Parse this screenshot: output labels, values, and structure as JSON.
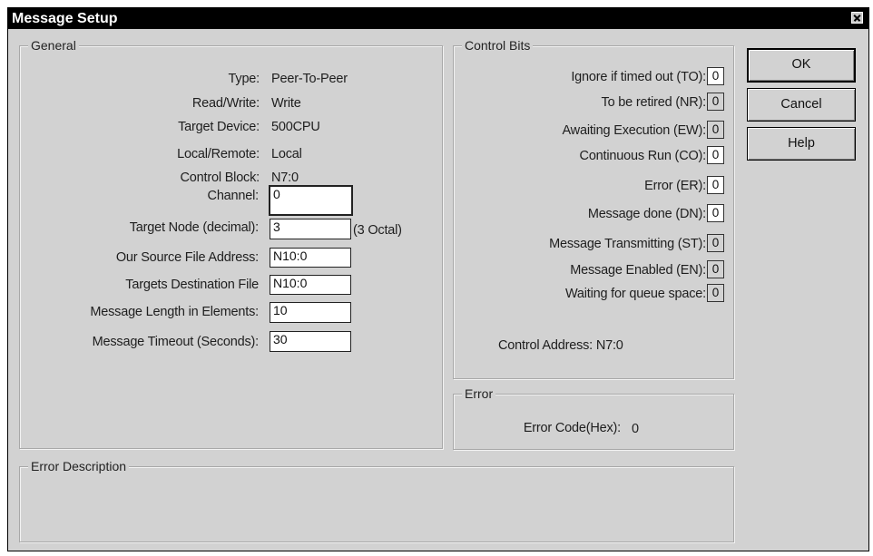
{
  "window": {
    "title": "Message Setup"
  },
  "general": {
    "legend": "General",
    "rows": [
      {
        "label": "Type:",
        "value": "Peer-To-Peer"
      },
      {
        "label": "Read/Write:",
        "value": "Write"
      },
      {
        "label": "Target Device:",
        "value": "500CPU"
      },
      {
        "label": "Local/Remote:",
        "value": "Local"
      },
      {
        "label": "Control Block:",
        "value": "N7:0"
      }
    ],
    "fields": [
      {
        "label": "Channel:",
        "value": "0"
      },
      {
        "label": "Target Node (decimal):",
        "value": "3",
        "suffix": "(3 Octal)"
      },
      {
        "label": "Our Source File Address:",
        "value": "N10:0"
      },
      {
        "label": "Targets Destination File",
        "value": "N10:0"
      },
      {
        "label": "Message Length in Elements:",
        "value": "10"
      },
      {
        "label": "Message Timeout (Seconds):",
        "value": "30"
      }
    ]
  },
  "control_bits": {
    "legend": "Control Bits",
    "bits": [
      {
        "label": "Ignore if timed out (TO):",
        "value": "0"
      },
      {
        "label": "To be retired (NR):",
        "value": "0"
      },
      {
        "label": "Awaiting Execution (EW):",
        "value": "0"
      },
      {
        "label": "Continuous Run (CO):",
        "value": "0"
      },
      {
        "label": "Error (ER):",
        "value": "0"
      },
      {
        "label": "Message done (DN):",
        "value": "0"
      },
      {
        "label": "Message Transmitting (ST):",
        "value": "0"
      },
      {
        "label": "Message Enabled (EN):",
        "value": "0"
      },
      {
        "label": "Waiting for queue space:",
        "value": "0"
      }
    ],
    "control_address": "Control Address: N7:0"
  },
  "error": {
    "legend": "Error",
    "code_label": "Error Code(Hex):",
    "code_value": "0"
  },
  "error_description": {
    "legend": "Error Description"
  },
  "buttons": {
    "ok": "OK",
    "cancel": "Cancel",
    "help": "Help"
  }
}
